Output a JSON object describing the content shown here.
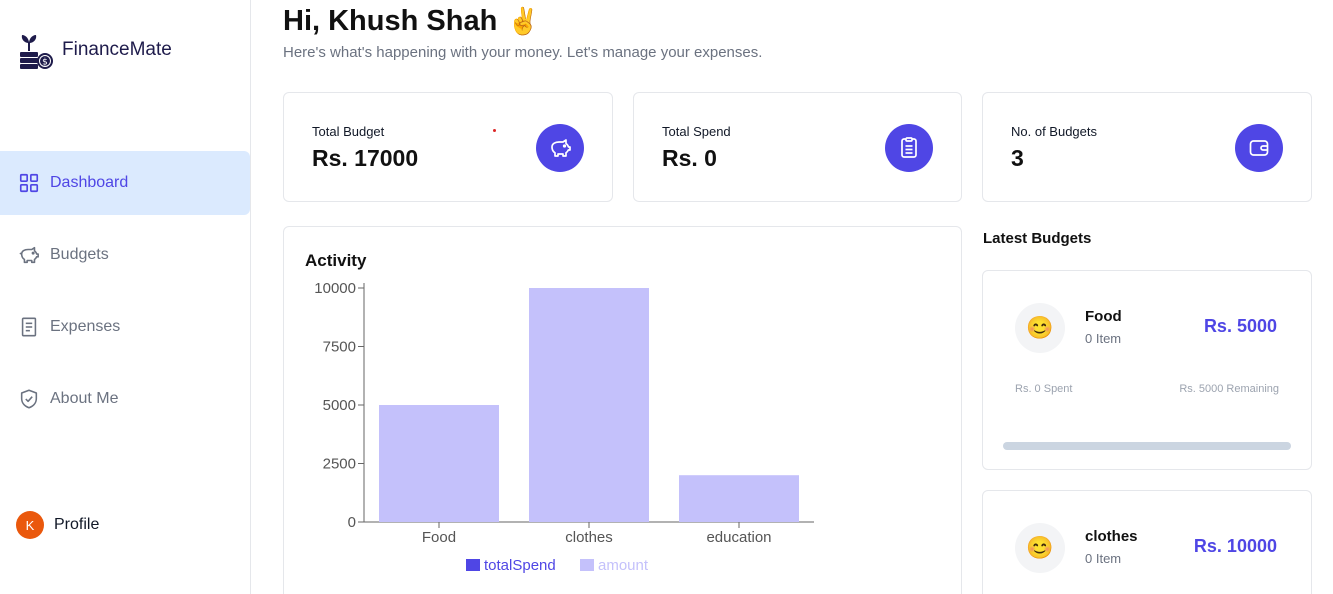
{
  "brand": {
    "name": "FinanceMate"
  },
  "sidebar": {
    "items": [
      {
        "label": "Dashboard",
        "icon": "grid-icon",
        "active": true
      },
      {
        "label": "Budgets",
        "icon": "piggy-bank-icon",
        "active": false
      },
      {
        "label": "Expenses",
        "icon": "receipt-icon",
        "active": false
      },
      {
        "label": "About Me",
        "icon": "shield-check-icon",
        "active": false
      }
    ],
    "profile": {
      "initial": "K",
      "label": "Profile"
    }
  },
  "header": {
    "greeting": "Hi, Khush Shah",
    "emoji": "✌️",
    "subtitle": "Here's what's happening with your money. Let's manage your expenses."
  },
  "stats": [
    {
      "label": "Total Budget",
      "value": "Rs. 17000",
      "icon": "piggy-bank-icon"
    },
    {
      "label": "Total Spend",
      "value": "Rs. 0",
      "icon": "receipt-icon"
    },
    {
      "label": "No. of Budgets",
      "value": "3",
      "icon": "wallet-icon"
    }
  ],
  "activity": {
    "title": "Activity"
  },
  "chart_data": {
    "type": "bar",
    "categories": [
      "Food",
      "clothes",
      "education"
    ],
    "series": [
      {
        "name": "totalSpend",
        "values": [
          0,
          0,
          0
        ],
        "color": "#4f46e5"
      },
      {
        "name": "amount",
        "values": [
          5000,
          10000,
          2000
        ],
        "color": "#c4c1fb"
      }
    ],
    "yticks": [
      0,
      2500,
      5000,
      7500,
      10000
    ],
    "ylim": [
      0,
      10000
    ],
    "legend": "bottom"
  },
  "latest": {
    "title": "Latest Budgets",
    "budgets": [
      {
        "emoji": "😊",
        "name": "Food",
        "items": "0 Item",
        "amount": "Rs. 5000",
        "spent": "Rs. 0 Spent",
        "remaining": "Rs. 5000 Remaining",
        "progress": 0
      },
      {
        "emoji": "😊",
        "name": "clothes",
        "items": "0 Item",
        "amount": "Rs. 10000"
      }
    ]
  },
  "colors": {
    "accent": "#4f46e5",
    "active_bg": "#dbeafe",
    "bar": "#c4c1fb",
    "avatar": "#ea580c"
  }
}
